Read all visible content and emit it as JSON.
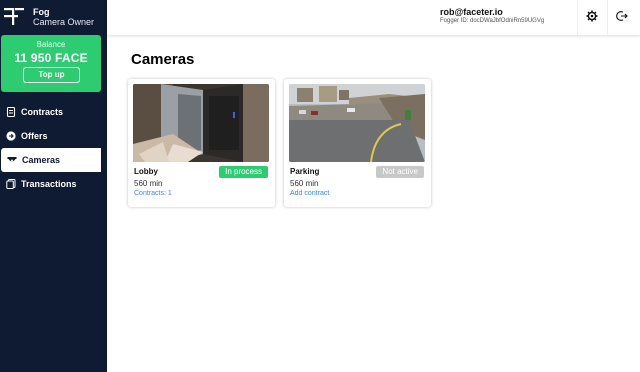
{
  "brand": {
    "name": "Fog",
    "role": "Camera Owner"
  },
  "balance": {
    "label": "Balance",
    "amount": "11 950 FACE",
    "topup_label": "Top up"
  },
  "nav": {
    "items": [
      {
        "label": "Contracts",
        "icon": "contracts-icon",
        "active": false
      },
      {
        "label": "Offers",
        "icon": "offers-arrow-icon",
        "active": false
      },
      {
        "label": "Cameras",
        "icon": "camera-icon",
        "active": true
      },
      {
        "label": "Transactions",
        "icon": "transactions-icon",
        "active": false
      }
    ]
  },
  "header": {
    "email": "rob@faceter.io",
    "fogger_id": "Fogger ID: docDWaJbfOdniRn59UGVg",
    "settings_icon": "gear-icon",
    "logout_icon": "logout-icon"
  },
  "main": {
    "title": "Cameras",
    "cameras": [
      {
        "name": "Lobby",
        "status": "In process",
        "status_color": "#2ecc71",
        "minutes": "560 min",
        "link": "Contracts: 1"
      },
      {
        "name": "Parking",
        "status": "Not active",
        "status_color": "#c8c8c8",
        "minutes": "560 min",
        "link": "Add contract"
      }
    ]
  },
  "colors": {
    "sidebar": "#0f1a33",
    "accent": "#2ecc71",
    "link": "#3b82f6"
  }
}
